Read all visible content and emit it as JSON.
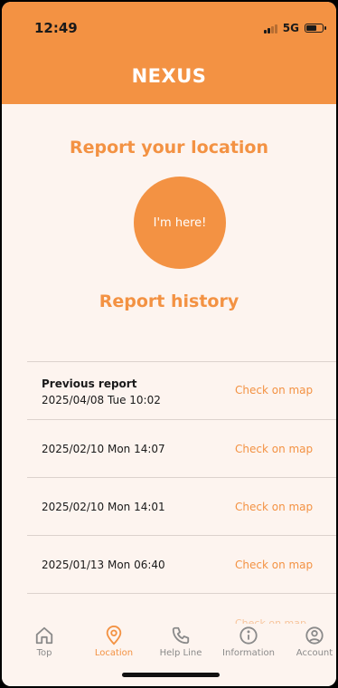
{
  "status_bar": {
    "time": "12:49",
    "network": "5G"
  },
  "header": {
    "title": "NEXUS"
  },
  "report": {
    "title": "Report your location",
    "button_label": "I'm here!"
  },
  "history": {
    "title": "Report history",
    "previous_label": "Previous report",
    "link_label": "Check on map",
    "entries": [
      "2025/04/08 Tue 10:02",
      "2025/02/10 Mon 14:07",
      "2025/02/10 Mon 14:01",
      "2025/01/13 Mon 06:40"
    ]
  },
  "tabs": [
    {
      "label": "Top",
      "icon": "home-icon",
      "active": false
    },
    {
      "label": "Location",
      "icon": "location-pin-icon",
      "active": true
    },
    {
      "label": "Help Line",
      "icon": "phone-icon",
      "active": false
    },
    {
      "label": "Information",
      "icon": "info-icon",
      "active": false
    },
    {
      "label": "Account",
      "icon": "user-icon",
      "active": false
    }
  ],
  "colors": {
    "accent": "#f39243",
    "background": "#fdf4ef",
    "muted": "#8a8a8a"
  }
}
